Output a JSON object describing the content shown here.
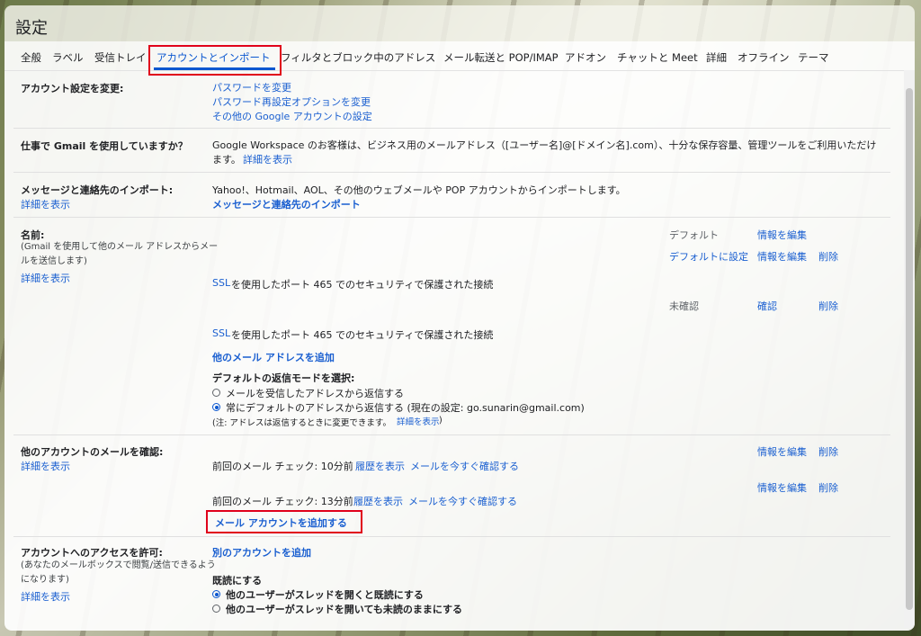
{
  "header": {
    "title": "設定"
  },
  "tabs": [
    "全般",
    "ラベル",
    "受信トレイ",
    "アカウントとインポート",
    "フィルタとブロック中のアドレス",
    "メール転送と POP/IMAP",
    "アドオン",
    "チャットと Meet",
    "詳細",
    "オフライン",
    "テーマ"
  ],
  "account_settings": {
    "label": "アカウント設定を変更:",
    "links": [
      "パスワードを変更",
      "パスワード再設定オプションを変更",
      "その他の Google アカウントの設定"
    ]
  },
  "workspace": {
    "label": "仕事で Gmail を使用していますか？",
    "text_line1": "Google Workspace のお客様は、ビジネス用のメールアドレス（[ユーザー名]@[ドメイン名].com）、十分な保存容量、管理ツールをご利用いただけ",
    "text_line2": "ます。",
    "link": "詳細を表示"
  },
  "import": {
    "label": "メッセージと連絡先のインポート:",
    "learn_more": "詳細を表示",
    "text": "Yahoo!、Hotmail、AOL、その他のウェブメールや POP アカウントからインポートします。",
    "link": "メッセージと連絡先のインポート"
  },
  "send_as": {
    "label": "名前:",
    "sub_line1": "(Gmail を使用して他のメール アドレスからメー",
    "sub_line2": "ルを送信します)",
    "learn_more": "詳細を表示",
    "default_text": "デフォルト",
    "edit_info": "情報を編集",
    "set_default": "デフォルトに設定",
    "delete": "削除",
    "ssl_text": "を使用したポート 465 でのセキュリティで保護された接続",
    "ssl_link": "SSL",
    "unverified": "未確認",
    "verify": "確認",
    "add_address": "他のメール アドレスを追加",
    "reply_mode_title": "デフォルトの返信モードを選択:",
    "reply_option1": "メールを受信したアドレスから返信する",
    "reply_option2": "常にデフォルトのアドレスから返信する (現在の設定: go.sunarin@gmail.com)",
    "note": "(注: アドレスは返信するときに変更できます。",
    "note_link": "詳細を表示",
    "note_end": ")"
  },
  "check_mail": {
    "label": "他のアカウントのメールを確認:",
    "learn_more": "詳細を表示",
    "edit_info": "情報を編集",
    "delete": "削除",
    "last_check_1": "前回のメール チェック: 10分前",
    "last_check_2": "前回のメール チェック: 13分前",
    "history": "履歴を表示",
    "check_now": "メールを今すぐ確認する",
    "add_account": "メール アカウントを追加する"
  },
  "grant_access": {
    "label": "アカウントへのアクセスを許可:",
    "sub_line1": "(あなたのメールボックスで閲覧/送信できるよう",
    "sub_line2": "になります)",
    "learn_more": "詳細を表示",
    "add_account": "別のアカウントを追加",
    "read_title": "既読にする",
    "read_option1": "他のユーザーがスレッドを開くと既読にする",
    "read_option2": "他のユーザーがスレッドを開いても未読のままにする"
  },
  "colors": {
    "accent": "#0b57d0",
    "link": "#1a5fd0",
    "highlight": "#e0001b"
  }
}
